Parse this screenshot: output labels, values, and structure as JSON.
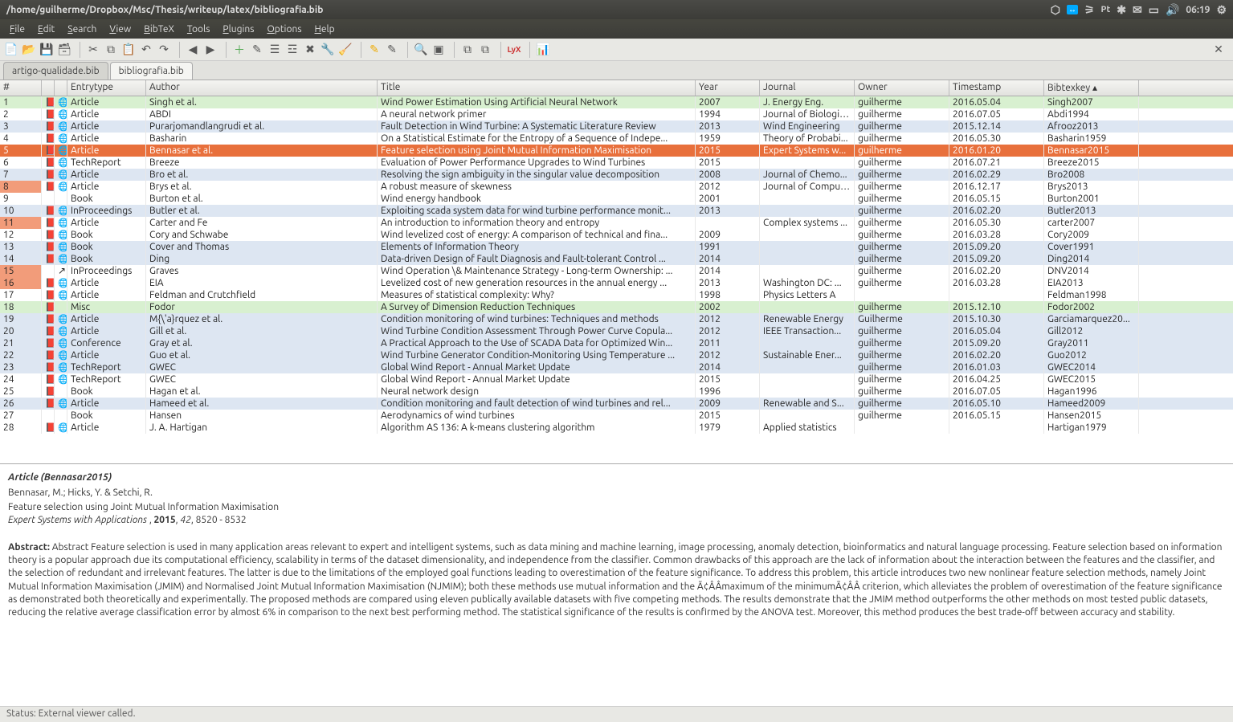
{
  "window": {
    "title": "/home/guilherme/Dropbox/Msc/Thesis/writeup/latex/bibliografia.bib",
    "clock": "06:19",
    "lang": "Pt"
  },
  "menus": [
    "File",
    "Edit",
    "Search",
    "View",
    "BibTeX",
    "Tools",
    "Plugins",
    "Options",
    "Help"
  ],
  "tabs": [
    {
      "label": "artigo-qualidade.bib",
      "active": false
    },
    {
      "label": "bibliografia.bib",
      "active": true
    }
  ],
  "columns": [
    "#",
    "",
    "",
    "Entrytype",
    "Author",
    "Title",
    "Year",
    "Journal",
    "Owner",
    "Timestamp",
    "Bibtexkey"
  ],
  "rows": [
    {
      "n": "1",
      "pdf": true,
      "www": true,
      "type": "Article",
      "author": "Singh et al.",
      "title": "Wind Power Estimation Using Artificial Neural Network",
      "year": "2007",
      "journal": "J. Energy Eng.",
      "owner": "guilherme",
      "ts": "2016.05.04",
      "key": "Singh2007",
      "cls": "green"
    },
    {
      "n": "2",
      "pdf": true,
      "www": true,
      "type": "Article",
      "author": "ABDI",
      "title": "A neural network primer",
      "year": "1994",
      "journal": "Journal of Biologic...",
      "owner": "guilherme",
      "ts": "2016.07.05",
      "key": "Abdi1994",
      "cls": ""
    },
    {
      "n": "3",
      "pdf": true,
      "www": true,
      "type": "Article",
      "author": "Purarjomandlangrudi et al.",
      "title": "Fault Detection in Wind Turbine: A Systematic Literature Review",
      "year": "2013",
      "journal": "Wind Engineering",
      "owner": "guilherme",
      "ts": "2015.12.14",
      "key": "Afrooz2013",
      "cls": "blue"
    },
    {
      "n": "4",
      "pdf": true,
      "www": true,
      "type": "Article",
      "author": "Basharin",
      "title": "On a Statistical Estimate for the Entropy of a Sequence of Indepe...",
      "year": "1959",
      "journal": "Theory of Probabi...",
      "owner": "guilherme",
      "ts": "2016.05.30",
      "key": "Basharin1959",
      "cls": ""
    },
    {
      "n": "5",
      "pdf": true,
      "www": true,
      "type": "Article",
      "author": "Bennasar et al.",
      "title": "Feature selection using Joint Mutual Information Maximisation",
      "year": "2015",
      "journal": "Expert Systems w...",
      "owner": "guilherme",
      "ts": "2016.01.20",
      "key": "Bennasar2015",
      "cls": "sel"
    },
    {
      "n": "6",
      "pdf": true,
      "www": true,
      "type": "TechReport",
      "author": "Breeze",
      "title": "Evaluation of Power Performance Upgrades to Wind Turbines",
      "year": "2015",
      "journal": "",
      "owner": "guilherme",
      "ts": "2016.07.21",
      "key": "Breeze2015",
      "cls": ""
    },
    {
      "n": "7",
      "pdf": true,
      "www": true,
      "type": "Article",
      "author": "Bro et al.",
      "title": "Resolving the sign ambiguity in the singular value decomposition",
      "year": "2008",
      "journal": "Journal of Chemo...",
      "owner": "guilherme",
      "ts": "2016.02.29",
      "key": "Bro2008",
      "cls": "blue"
    },
    {
      "n": "8",
      "pdf": true,
      "www": true,
      "type": "Article",
      "author": "Brys et al.",
      "title": "A robust measure of skewness",
      "year": "2012",
      "journal": "Journal of Comput...",
      "owner": "guilherme",
      "ts": "2016.12.17",
      "key": "Brys2013",
      "cls": "mark"
    },
    {
      "n": "9",
      "pdf": false,
      "www": false,
      "type": "Book",
      "author": "Burton et al.",
      "title": "Wind energy handbook",
      "year": "2001",
      "journal": "",
      "owner": "guilherme",
      "ts": "2016.05.15",
      "key": "Burton2001",
      "cls": ""
    },
    {
      "n": "10",
      "pdf": true,
      "www": true,
      "type": "InProceedings",
      "author": "Butler et al.",
      "title": "Exploiting scada system data for wind turbine performance monit...",
      "year": "2013",
      "journal": "",
      "owner": "guilherme",
      "ts": "2016.02.20",
      "key": "Butler2013",
      "cls": "blue"
    },
    {
      "n": "11",
      "pdf": true,
      "www": true,
      "type": "Article",
      "author": "Carter and Fe",
      "title": "An introduction to information theory and entropy",
      "year": "",
      "journal": "Complex systems ...",
      "owner": "guilherme",
      "ts": "2016.05.30",
      "key": "carter2007",
      "cls": "mark"
    },
    {
      "n": "12",
      "pdf": true,
      "www": true,
      "type": "Book",
      "author": "Cory and Schwabe",
      "title": "Wind levelized cost of energy: A comparison of technical and fina...",
      "year": "2009",
      "journal": "",
      "owner": "guilherme",
      "ts": "2016.03.28",
      "key": "Cory2009",
      "cls": ""
    },
    {
      "n": "13",
      "pdf": true,
      "www": true,
      "type": "Book",
      "author": "Cover and Thomas",
      "title": "Elements of Information Theory",
      "year": "1991",
      "journal": "",
      "owner": "guilherme",
      "ts": "2015.09.20",
      "key": "Cover1991",
      "cls": "blue"
    },
    {
      "n": "14",
      "pdf": true,
      "www": true,
      "type": "Book",
      "author": "Ding",
      "title": "Data-driven Design of Fault Diagnosis and Fault-tolerant Control ...",
      "year": "2014",
      "journal": "",
      "owner": "guilherme",
      "ts": "2015.09.20",
      "key": "Ding2014",
      "cls": "blue"
    },
    {
      "n": "15",
      "pdf": false,
      "www": false,
      "ext": true,
      "type": "InProceedings",
      "author": "Graves",
      "title": "Wind Operation \\& Maintenance Strategy - Long-term Ownership: ...",
      "year": "2014",
      "journal": "",
      "owner": "guilherme",
      "ts": "2016.02.20",
      "key": "DNV2014",
      "cls": "mark"
    },
    {
      "n": "16",
      "pdf": true,
      "www": true,
      "type": "Article",
      "author": "EIA",
      "title": "Levelized cost of new generation resources in the annual energy ...",
      "year": "2013",
      "journal": "Washington DC: ...",
      "owner": "guilherme",
      "ts": "2016.03.28",
      "key": "EIA2013",
      "cls": "mark"
    },
    {
      "n": "17",
      "pdf": true,
      "www": true,
      "type": "Article",
      "author": "Feldman and Crutchfield",
      "title": "Measures of statistical complexity: Why?",
      "year": "1998",
      "journal": "Physics Letters A",
      "owner": "",
      "ts": "",
      "key": "Feldman1998",
      "cls": ""
    },
    {
      "n": "18",
      "pdf": true,
      "www": false,
      "type": "Misc",
      "author": "Fodor",
      "title": "A Survey of Dimension Reduction Techniques",
      "year": "2002",
      "journal": "",
      "owner": "guilherme",
      "ts": "2015.12.10",
      "key": "Fodor2002",
      "cls": "green"
    },
    {
      "n": "19",
      "pdf": true,
      "www": true,
      "type": "Article",
      "author": "M{\\'a}rquez et al.",
      "title": "Condition monitoring of wind turbines: Techniques and methods",
      "year": "2012",
      "journal": "Renewable Energy",
      "owner": "Guilherme",
      "ts": "2015.10.30",
      "key": "Garciamarquez20...",
      "cls": "blue"
    },
    {
      "n": "20",
      "pdf": true,
      "www": true,
      "type": "Article",
      "author": "Gill et al.",
      "title": "Wind Turbine Condition Assessment Through Power Curve Copula...",
      "year": "2012",
      "journal": "IEEE Transaction...",
      "owner": "guilherme",
      "ts": "2016.05.04",
      "key": "Gill2012",
      "cls": "blue"
    },
    {
      "n": "21",
      "pdf": true,
      "www": true,
      "type": "Conference",
      "author": "Gray et al.",
      "title": "A Practical Approach to the Use of SCADA Data for Optimized Win...",
      "year": "2011",
      "journal": "",
      "owner": "guilherme",
      "ts": "2015.09.20",
      "key": "Gray2011",
      "cls": "blue"
    },
    {
      "n": "22",
      "pdf": true,
      "www": true,
      "type": "Article",
      "author": "Guo et al.",
      "title": "Wind Turbine Generator Condition-Monitoring Using Temperature ...",
      "year": "2012",
      "journal": "Sustainable Ener...",
      "owner": "guilherme",
      "ts": "2016.02.20",
      "key": "Guo2012",
      "cls": "blue"
    },
    {
      "n": "23",
      "pdf": true,
      "www": true,
      "type": "TechReport",
      "author": "GWEC",
      "title": "Global Wind Report - Annual Market Update",
      "year": "2014",
      "journal": "",
      "owner": "guilherme",
      "ts": "2016.01.03",
      "key": "GWEC2014",
      "cls": "blue"
    },
    {
      "n": "24",
      "pdf": true,
      "www": true,
      "type": "TechReport",
      "author": "GWEC",
      "title": "Global Wind Report - Annual Market Update",
      "year": "2015",
      "journal": "",
      "owner": "guilherme",
      "ts": "2016.04.25",
      "key": "GWEC2015",
      "cls": ""
    },
    {
      "n": "25",
      "pdf": true,
      "www": false,
      "type": "Book",
      "author": "Hagan et al.",
      "title": "Neural network design",
      "year": "1996",
      "journal": "",
      "owner": "guilherme",
      "ts": "2016.07.05",
      "key": "Hagan1996",
      "cls": ""
    },
    {
      "n": "26",
      "pdf": true,
      "www": true,
      "type": "Article",
      "author": "Hameed et al.",
      "title": "Condition monitoring and fault detection of wind turbines and rel...",
      "year": "2009",
      "journal": "Renewable and S...",
      "owner": "guilherme",
      "ts": "2016.05.10",
      "key": "Hameed2009",
      "cls": "blue"
    },
    {
      "n": "27",
      "pdf": false,
      "www": false,
      "type": "Book",
      "author": "Hansen",
      "title": "Aerodynamics of wind turbines",
      "year": "2015",
      "journal": "",
      "owner": "guilherme",
      "ts": "2016.05.15",
      "key": "Hansen2015",
      "cls": ""
    },
    {
      "n": "28",
      "pdf": true,
      "www": true,
      "type": "Article",
      "author": "J. A. Hartigan",
      "title": "Algorithm AS 136: A k-means clustering algorithm",
      "year": "1979",
      "journal": "Applied statistics",
      "owner": "",
      "ts": "",
      "key": "Hartigan1979",
      "cls": ""
    }
  ],
  "preview": {
    "type": "Article",
    "key": "Bennasar2015",
    "authors": "Bennasar, M.; Hicks, Y. & Setchi, R.",
    "title": "Feature selection using Joint Mutual Information Maximisation",
    "pub": "Expert Systems with Applications",
    "year": "2015",
    "vol": "42",
    "pages": "8520 - 8532",
    "abstract_label": "Abstract:",
    "abstract": "Abstract Feature selection is used in many application areas relevant to expert and intelligent systems, such as data mining and machine learning, image processing, anomaly detection, bioinformatics and natural language processing. Feature selection based on information theory is a popular approach due its computational efficiency, scalability in terms of the dataset dimensionality, and independence from the classifier. Common drawbacks of this approach are the lack of information about the interaction between the features and the classifier, and the selection of redundant and irrelevant features. The latter is due to the limitations of the employed goal functions leading to overestimation of the feature significance. To address this problem, this article introduces two new nonlinear feature selection methods, namely Joint Mutual Information Maximisation (JMIM) and Normalised Joint Mutual Information Maximisation (NJMIM); both these methods use mutual information and the Ã¢ÂÂmaximum of the minimumÃ¢ÂÂ criterion, which alleviates the problem of overestimation of the feature significance as demonstrated both theoretically and experimentally. The proposed methods are compared using eleven publically available datasets with five competing methods. The results demonstrate that the JMIM method outperforms the other methods on most tested public datasets, reducing the relative average classification error by almost 6% in comparison to the next best performing method. The statistical significance of the results is confirmed by the ANOVA test. Moreover, this method produces the best trade-off between accuracy and stability."
  },
  "status": "Status: External viewer called."
}
